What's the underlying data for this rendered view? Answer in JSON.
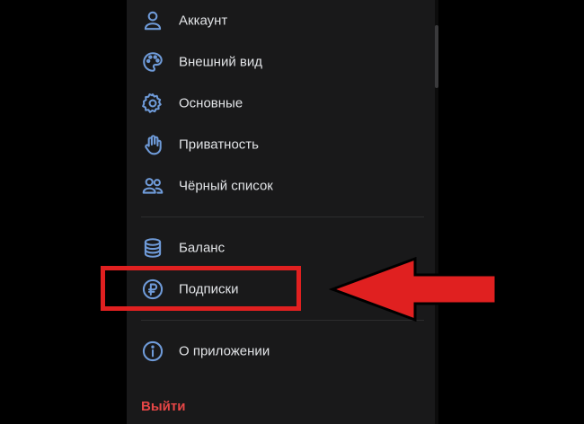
{
  "menu": {
    "items": [
      {
        "label": "Аккаунт",
        "icon": "user-icon"
      },
      {
        "label": "Внешний вид",
        "icon": "palette-icon"
      },
      {
        "label": "Основные",
        "icon": "gear-icon"
      },
      {
        "label": "Приватность",
        "icon": "hand-icon"
      },
      {
        "label": "Чёрный список",
        "icon": "users-icon"
      },
      {
        "label": "Баланс",
        "icon": "coins-icon"
      },
      {
        "label": "Подписки",
        "icon": "ruble-icon"
      },
      {
        "label": "О приложении",
        "icon": "info-icon"
      }
    ],
    "logout_label": "Выйти"
  },
  "colors": {
    "background": "#19191a",
    "icon": "#6f9bd9",
    "text": "#e1e3e6",
    "logout": "#e64646",
    "annotation": "#e02020"
  }
}
